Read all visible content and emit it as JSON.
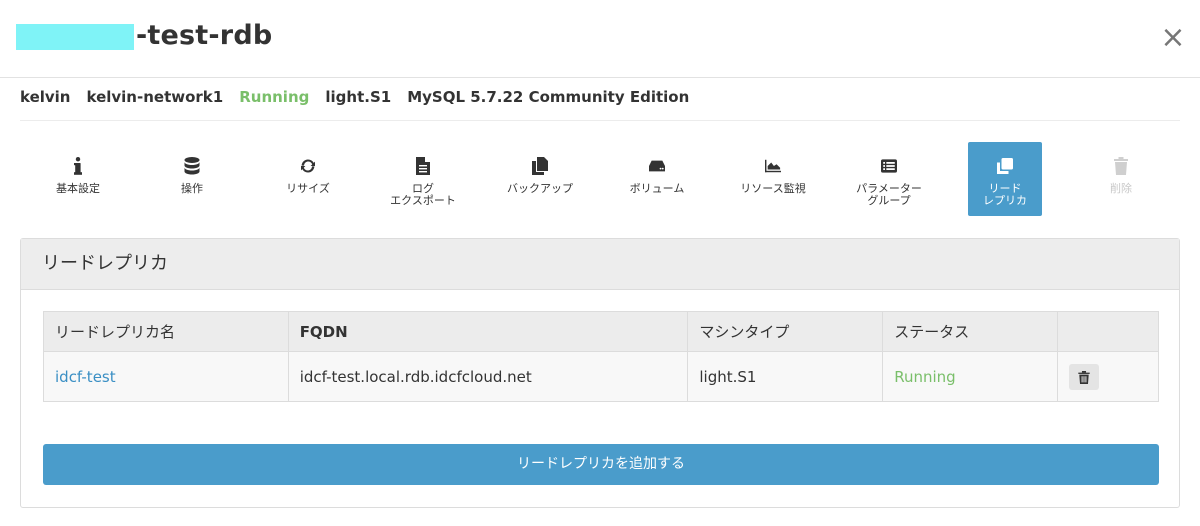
{
  "header": {
    "title_suffix": "-test-rdb",
    "close_label": "×"
  },
  "info": {
    "user": "kelvin",
    "network": "kelvin-network1",
    "status": "Running",
    "plan": "light.S1",
    "engine": "MySQL 5.7.22 Community Edition"
  },
  "menu": [
    {
      "label": "基本設定",
      "icon": "info-icon"
    },
    {
      "label": "操作",
      "icon": "database-icon"
    },
    {
      "label": "リサイズ",
      "icon": "refresh-icon"
    },
    {
      "label": "ログ\nエクスポート",
      "icon": "file-text-icon"
    },
    {
      "label": "バックアップ",
      "icon": "copy-icon"
    },
    {
      "label": "ボリューム",
      "icon": "hdd-icon"
    },
    {
      "label": "リソース監視",
      "icon": "area-chart-icon"
    },
    {
      "label": "パラメーター\nグループ",
      "icon": "list-alt-icon"
    },
    {
      "label": "リード\nレプリカ",
      "icon": "clone-icon",
      "active": true
    },
    {
      "label": "削除",
      "icon": "trash-icon",
      "disabled": true
    }
  ],
  "panel": {
    "title": "リードレプリカ",
    "table": {
      "columns": [
        "リードレプリカ名",
        "FQDN",
        "マシンタイプ",
        "ステータス",
        ""
      ],
      "rows": [
        {
          "name": "idcf-test",
          "fqdn": "idcf-test.local.rdb.idcfcloud.net",
          "machine_type": "light.S1",
          "status": "Running"
        }
      ]
    },
    "add_button": "リードレプリカを追加する"
  },
  "colors": {
    "accent": "#4a9ccb",
    "running": "#7abf6a",
    "link": "#3a8fc4",
    "redaction": "#7ff3f7"
  }
}
